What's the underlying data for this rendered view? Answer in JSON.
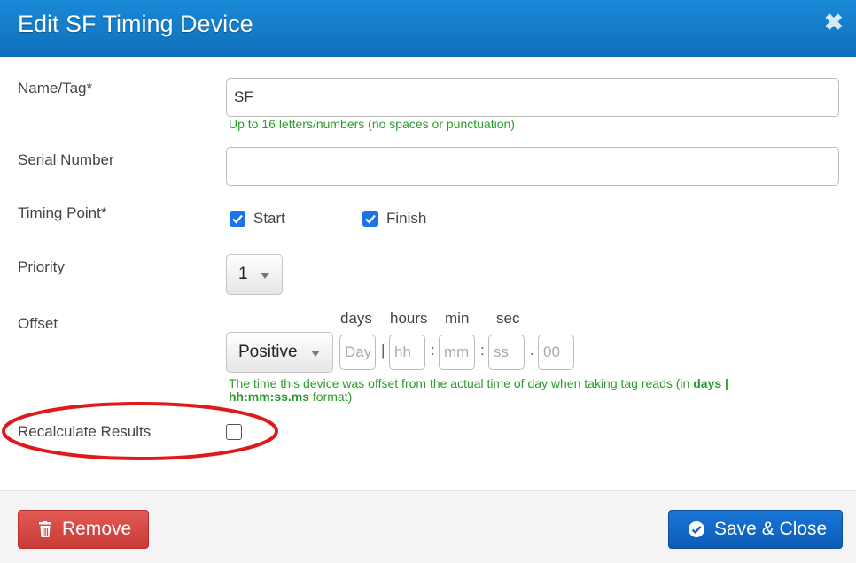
{
  "dialog": {
    "title": "Edit SF Timing Device",
    "close_icon": "close-icon"
  },
  "form": {
    "name_label": "Name/Tag*",
    "name_value": "SF",
    "name_help": "Up to 16 letters/numbers (no spaces or punctuation)",
    "serial_label": "Serial Number",
    "serial_value": "",
    "timing_point_label": "Timing Point*",
    "start_label": "Start",
    "start_checked": true,
    "finish_label": "Finish",
    "finish_checked": true,
    "priority_label": "Priority",
    "priority_value": "1",
    "offset_label": "Offset",
    "offset_sign": "Positive",
    "offset_headers": {
      "days": "days",
      "hours": "hours",
      "min": "min",
      "sec": "sec"
    },
    "offset_placeholders": {
      "days": "Day",
      "hours": "hh",
      "min": "mm",
      "sec": "ss",
      "ms": "00"
    },
    "offset_separators": {
      "bar": "|",
      "colon": ":",
      "dot": "."
    },
    "offset_help_prefix": "The time this device was offset from the actual time of day when taking tag reads (in ",
    "offset_help_bold": "days | hh:mm:ss.ms",
    "offset_help_suffix": " format)",
    "recalc_label": "Recalculate Results",
    "recalc_checked": false
  },
  "footer": {
    "remove_label": "Remove",
    "save_label": "Save & Close"
  },
  "colors": {
    "header": "#1a8ad8",
    "help_text": "#2a9b2a",
    "remove_button": "#d9534f",
    "save_button": "#1566c8",
    "annotation_ellipse": "#e0191b"
  }
}
